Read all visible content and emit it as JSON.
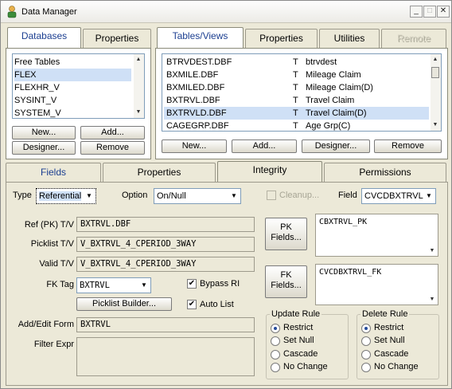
{
  "window": {
    "title": "Data Manager",
    "minimize": "_",
    "maximize": "□",
    "close": "✕"
  },
  "left_tabs": [
    "Databases",
    "Properties"
  ],
  "databases": [
    "Free Tables",
    "FLEX",
    "FLEXHR_V",
    "SYSINT_V",
    "SYSTEM_V"
  ],
  "db_buttons": {
    "new": "New...",
    "add": "Add...",
    "designer": "Designer...",
    "remove": "Remove"
  },
  "right_tabs": [
    "Tables/Views",
    "Properties",
    "Utilities",
    "Remote"
  ],
  "tables": [
    {
      "name": "BTRVDEST.DBF",
      "type": "T",
      "desc": "btrvdest"
    },
    {
      "name": "BXMILE.DBF",
      "type": "T",
      "desc": "Mileage Claim"
    },
    {
      "name": "BXMILED.DBF",
      "type": "T",
      "desc": "Mileage Claim(D)"
    },
    {
      "name": "BXTRVL.DBF",
      "type": "T",
      "desc": "Travel Claim"
    },
    {
      "name": "BXTRVLD.DBF",
      "type": "T",
      "desc": "Travel Claim(D)"
    },
    {
      "name": "CAGEGRP.DBF",
      "type": "T",
      "desc": "Age Grp(C)"
    }
  ],
  "tbl_buttons": {
    "new": "New...",
    "add": "Add...",
    "designer": "Designer...",
    "remove": "Remove"
  },
  "bottom_tabs": [
    "Fields",
    "Properties",
    "Integrity",
    "Permissions"
  ],
  "integrity": {
    "type_label": "Type",
    "type_value": "Referential",
    "option_label": "Option",
    "option_value": "On/Null",
    "cleanup_label": "Cleanup...",
    "field_label": "Field",
    "field_value": "CVCDBXTRVL",
    "ref_label": "Ref (PK) T/V",
    "ref_value": "BXTRVL.DBF",
    "picklist_label": "Picklist T/V",
    "picklist_value": "V_BXTRVL_4_CPERIOD_3WAY",
    "valid_label": "Valid T/V",
    "valid_value": "V_BXTRVL_4_CPERIOD_3WAY",
    "fktag_label": "FK Tag",
    "fktag_value": "BXTRVL",
    "bypass_label": "Bypass RI",
    "autolist_label": "Auto List",
    "picklist_builder": "Picklist Builder...",
    "addedit_label": "Add/Edit Form",
    "addedit_value": "BXTRVL",
    "filter_label": "Filter Expr",
    "pk_button": "PK Fields...",
    "pk_value": "CBXTRVL_PK",
    "fk_button": "FK Fields...",
    "fk_value": "CVCDBXTRVL_FK",
    "update_rule_label": "Update Rule",
    "delete_rule_label": "Delete Rule",
    "rule_options": [
      "Restrict",
      "Set Null",
      "Cascade",
      "No Change"
    ]
  }
}
